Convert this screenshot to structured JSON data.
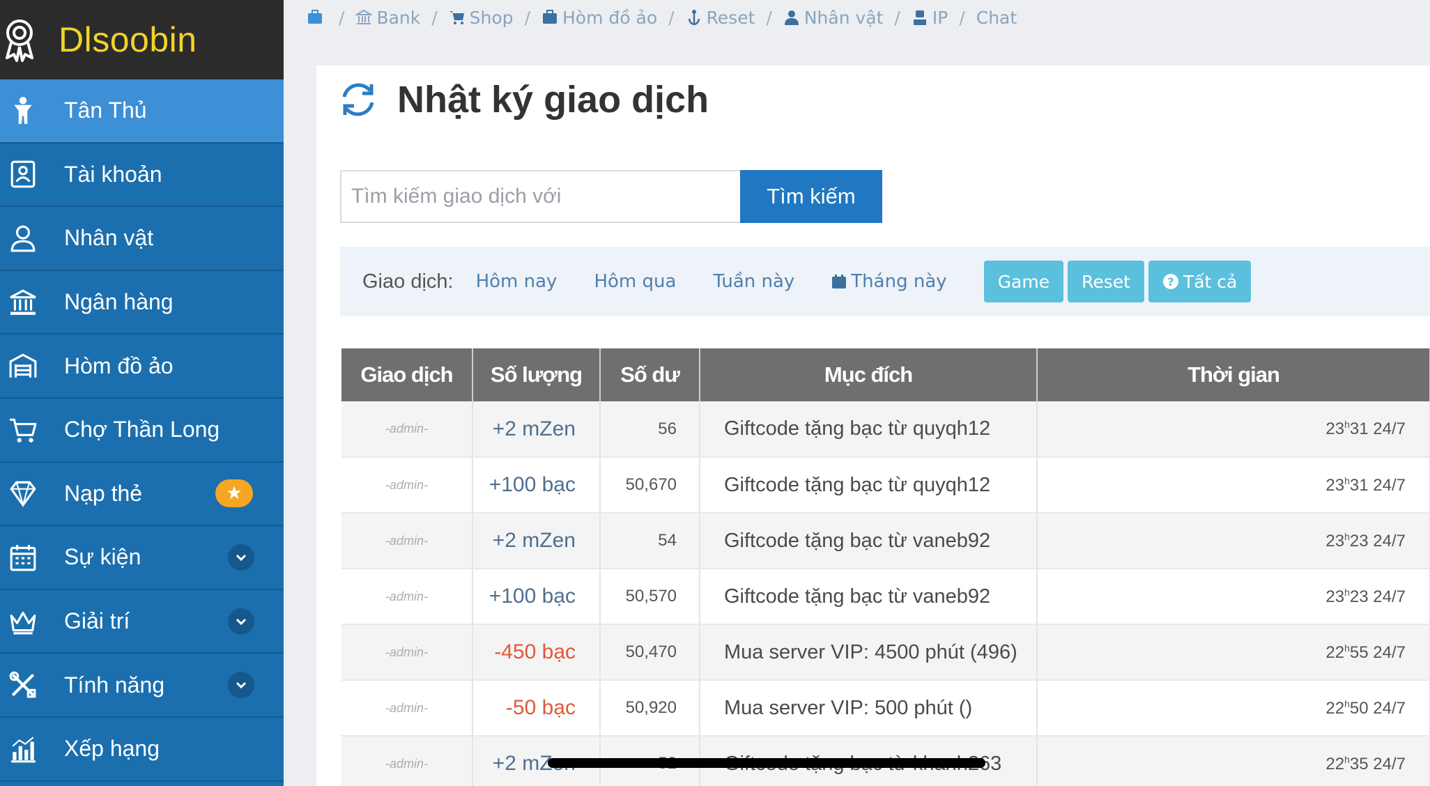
{
  "brand": {
    "name": "Dlsoobin"
  },
  "sidebar": {
    "items": [
      {
        "label": "Tân Thủ",
        "icon": "person-icon",
        "active": true
      },
      {
        "label": "Tài khoản",
        "icon": "account-card-icon"
      },
      {
        "label": "Nhân vật",
        "icon": "user-icon"
      },
      {
        "label": "Ngân hàng",
        "icon": "bank-icon"
      },
      {
        "label": "Hòm đồ ảo",
        "icon": "warehouse-icon"
      },
      {
        "label": "Chợ Thần Long",
        "icon": "cart-icon"
      },
      {
        "label": "Nạp thẻ",
        "icon": "diamond-icon",
        "badge": "★"
      },
      {
        "label": "Sự kiện",
        "icon": "calendar-icon",
        "has_submenu": true
      },
      {
        "label": "Giải trí",
        "icon": "crown-icon",
        "has_submenu": true
      },
      {
        "label": "Tính năng",
        "icon": "tools-icon",
        "has_submenu": true
      },
      {
        "label": "Xếp hạng",
        "icon": "chart-icon"
      }
    ]
  },
  "breadcrumb": [
    {
      "label": "",
      "icon": "briefcase-icon"
    },
    {
      "label": "Bank",
      "icon": "bank-icon"
    },
    {
      "label": "Shop",
      "icon": "cart-icon"
    },
    {
      "label": "Hòm đồ ảo",
      "icon": "briefcase-icon"
    },
    {
      "label": "Reset",
      "icon": "anchor-icon"
    },
    {
      "label": "Nhân vật",
      "icon": "user-icon"
    },
    {
      "label": "IP",
      "icon": "ip-user-icon"
    },
    {
      "label": "Chat",
      "icon": ""
    }
  ],
  "page": {
    "title": "Nhật ký giao dịch"
  },
  "search": {
    "placeholder": "Tìm kiếm giao dịch với",
    "button_label": "Tìm kiếm"
  },
  "filter": {
    "label": "Giao dịch:",
    "links": [
      "Hôm nay",
      "Hôm qua",
      "Tuần này",
      "Tháng này"
    ],
    "buttons": [
      "Game",
      "Reset",
      "Tất cả"
    ]
  },
  "table": {
    "headers": [
      "Giao dịch",
      "Số lượng",
      "Số dư",
      "Mục đích",
      "Thời gian"
    ],
    "rows": [
      {
        "source": "-admin-",
        "amount": "+2 mZen",
        "negative": false,
        "balance": "56",
        "purpose": "Giftcode tặng bạc từ quyqh12",
        "hour": "23",
        "minute": "31",
        "date": "24/7"
      },
      {
        "source": "-admin-",
        "amount": "+100 bạc",
        "negative": false,
        "balance": "50,670",
        "purpose": "Giftcode tặng bạc từ quyqh12",
        "hour": "23",
        "minute": "31",
        "date": "24/7"
      },
      {
        "source": "-admin-",
        "amount": "+2 mZen",
        "negative": false,
        "balance": "54",
        "purpose": "Giftcode tặng bạc từ vaneb92",
        "hour": "23",
        "minute": "23",
        "date": "24/7"
      },
      {
        "source": "-admin-",
        "amount": "+100 bạc",
        "negative": false,
        "balance": "50,570",
        "purpose": "Giftcode tặng bạc từ vaneb92",
        "hour": "23",
        "minute": "23",
        "date": "24/7"
      },
      {
        "source": "-admin-",
        "amount": "-450 bạc",
        "negative": true,
        "balance": "50,470",
        "purpose": "Mua server VIP: 4500 phút (496)",
        "hour": "22",
        "minute": "55",
        "date": "24/7"
      },
      {
        "source": "-admin-",
        "amount": "-50 bạc",
        "negative": true,
        "balance": "50,920",
        "purpose": "Mua server VIP: 500 phút ()",
        "hour": "22",
        "minute": "50",
        "date": "24/7"
      },
      {
        "source": "-admin-",
        "amount": "+2 mZen",
        "negative": false,
        "balance": "52",
        "purpose": "Giftcode tặng bạc từ khanh263",
        "hour": "22",
        "minute": "35",
        "date": "24/7"
      }
    ]
  },
  "colors": {
    "sidebar_bg": "#1b6fae",
    "sidebar_active": "#3d8fd6",
    "brand_bg": "#2b2b2b",
    "brand_text": "#f1d32b",
    "primary_button": "#1f78c1",
    "info_button": "#5bc0de",
    "negative_amount": "#e0583a",
    "badge": "#f5a623"
  }
}
